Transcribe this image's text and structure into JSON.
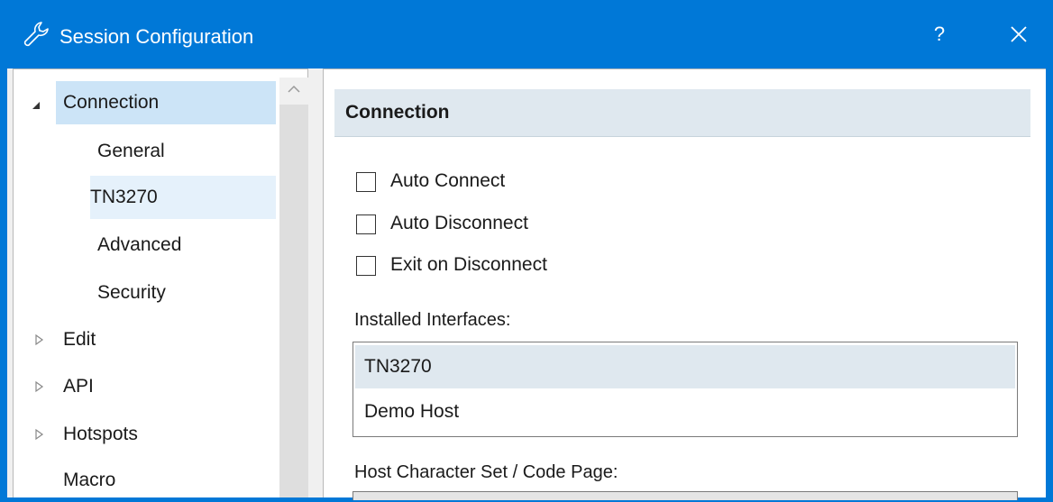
{
  "window": {
    "title": "Session Configuration",
    "help_label": "?",
    "icons": {
      "app": "wrench-icon",
      "close": "close-icon"
    }
  },
  "nav": {
    "items": [
      {
        "label": "Connection",
        "level": 0,
        "expanded": true,
        "selected": true
      },
      {
        "label": "General",
        "level": 1
      },
      {
        "label": "TN3270",
        "level": 1,
        "hovered": true
      },
      {
        "label": "Advanced",
        "level": 1
      },
      {
        "label": "Security",
        "level": 1
      },
      {
        "label": "Edit",
        "level": 0,
        "expanded": false
      },
      {
        "label": "API",
        "level": 0,
        "expanded": false
      },
      {
        "label": "Hotspots",
        "level": 0,
        "expanded": false
      },
      {
        "label": "Macro",
        "level": 0
      }
    ]
  },
  "content": {
    "header": "Connection",
    "checkboxes": [
      {
        "label": "Auto Connect",
        "checked": false
      },
      {
        "label": "Auto Disconnect",
        "checked": false
      },
      {
        "label": "Exit on Disconnect",
        "checked": false
      }
    ],
    "interfaces_label": "Installed Interfaces:",
    "interfaces": [
      "TN3270",
      "Demo Host"
    ],
    "selected_interface": "TN3270",
    "charset_label": "Host Character Set / Code Page:"
  },
  "colors": {
    "titlebar": "#0078d7",
    "nav_selected": "#cce4f7",
    "header_bg": "#dfe8ef",
    "list_selected": "#dfe8ef"
  }
}
